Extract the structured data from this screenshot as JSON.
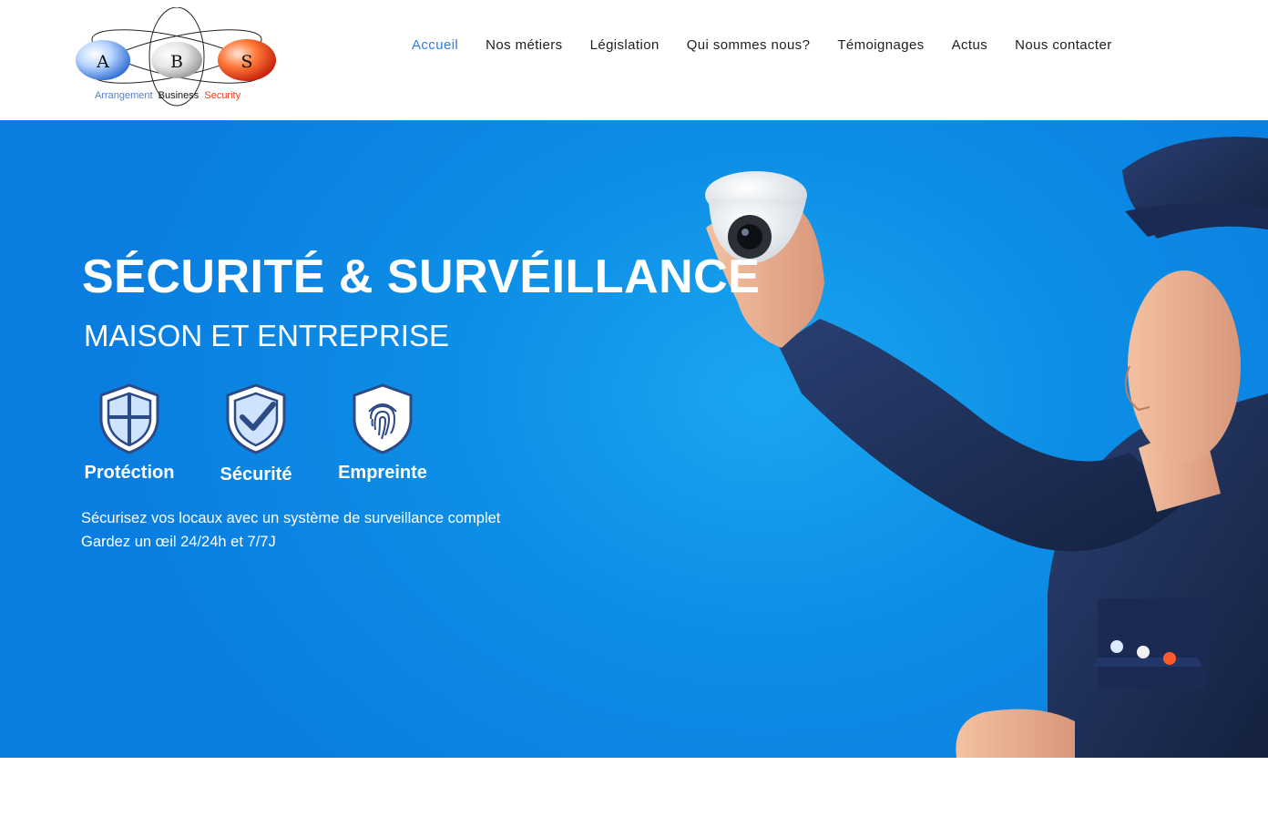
{
  "header": {
    "logo": {
      "letters": [
        "A",
        "B",
        "S"
      ],
      "tagline_parts": [
        "Arrangement",
        "Business",
        "Security"
      ]
    },
    "nav": [
      {
        "label": "Accueil",
        "active": true
      },
      {
        "label": "Nos métiers",
        "active": false
      },
      {
        "label": "Législation",
        "active": false
      },
      {
        "label": "Qui sommes nous?",
        "active": false
      },
      {
        "label": "Témoignages",
        "active": false
      },
      {
        "label": "Actus",
        "active": false
      },
      {
        "label": "Nous contacter",
        "active": false
      }
    ]
  },
  "hero": {
    "title": "SÉCURITÉ & SURVÉILLANCE",
    "subtitle": "MAISON ET ENTREPRISE",
    "features": [
      {
        "label": "Protéction",
        "icon": "shield-cross-icon"
      },
      {
        "label": "Sécurité",
        "icon": "shield-check-icon"
      },
      {
        "label": "Empreinte",
        "icon": "fingerprint-icon"
      }
    ],
    "text_line1": "Sécurisez vos locaux avec un système de surveillance complet",
    "text_line2": "Gardez un œil 24/24h et 7/7J",
    "image": {
      "subject": "technician-holding-camera",
      "badge_letters": [
        "A",
        "B",
        "S"
      ]
    }
  },
  "colors": {
    "nav_active": "#2f7dd8",
    "nav_text": "#1e1e1e",
    "hero_blue": "#0d8fe6",
    "uniform_navy": "#1c2f5c",
    "logo_blue": "#4d7fd6",
    "logo_red": "#e2431c"
  }
}
